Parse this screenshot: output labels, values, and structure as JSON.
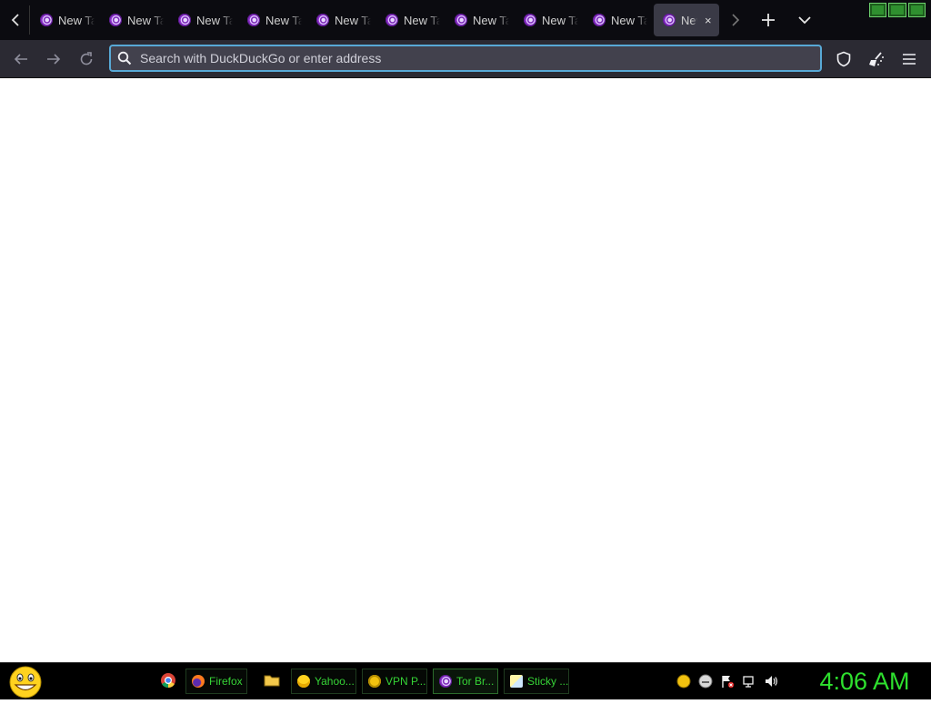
{
  "tabs": [
    {
      "label": "New Tab"
    },
    {
      "label": "New Tab"
    },
    {
      "label": "New Tab"
    },
    {
      "label": "New Tab"
    },
    {
      "label": "New Tab"
    },
    {
      "label": "New Tab"
    },
    {
      "label": "New Tab"
    },
    {
      "label": "New Tab"
    },
    {
      "label": "New Tab"
    },
    {
      "label": "New Tab",
      "active": true
    }
  ],
  "active_tab_close": "×",
  "navbar": {
    "search_placeholder": "Search with DuckDuckGo or enter address"
  },
  "taskbar": {
    "tasks": [
      {
        "label": "Firefox",
        "icon": "firefox-icon"
      },
      {
        "label": "Yahoo...",
        "icon": "yahoo-smiley-icon"
      },
      {
        "label": "VPN P...",
        "icon": "vpn-icon"
      },
      {
        "label": "Tor Br...",
        "icon": "tor-icon",
        "active": true
      },
      {
        "label": "Sticky ...",
        "icon": "sticky-notes-icon"
      }
    ],
    "clock": "4:06 AM"
  },
  "colors": {
    "tab_strip_bg": "#0b0b10",
    "navbar_bg": "#2b2a33",
    "urlbar_focus": "#58a9d6",
    "taskbar_text": "#36d336",
    "clock": "#2ee02e"
  }
}
